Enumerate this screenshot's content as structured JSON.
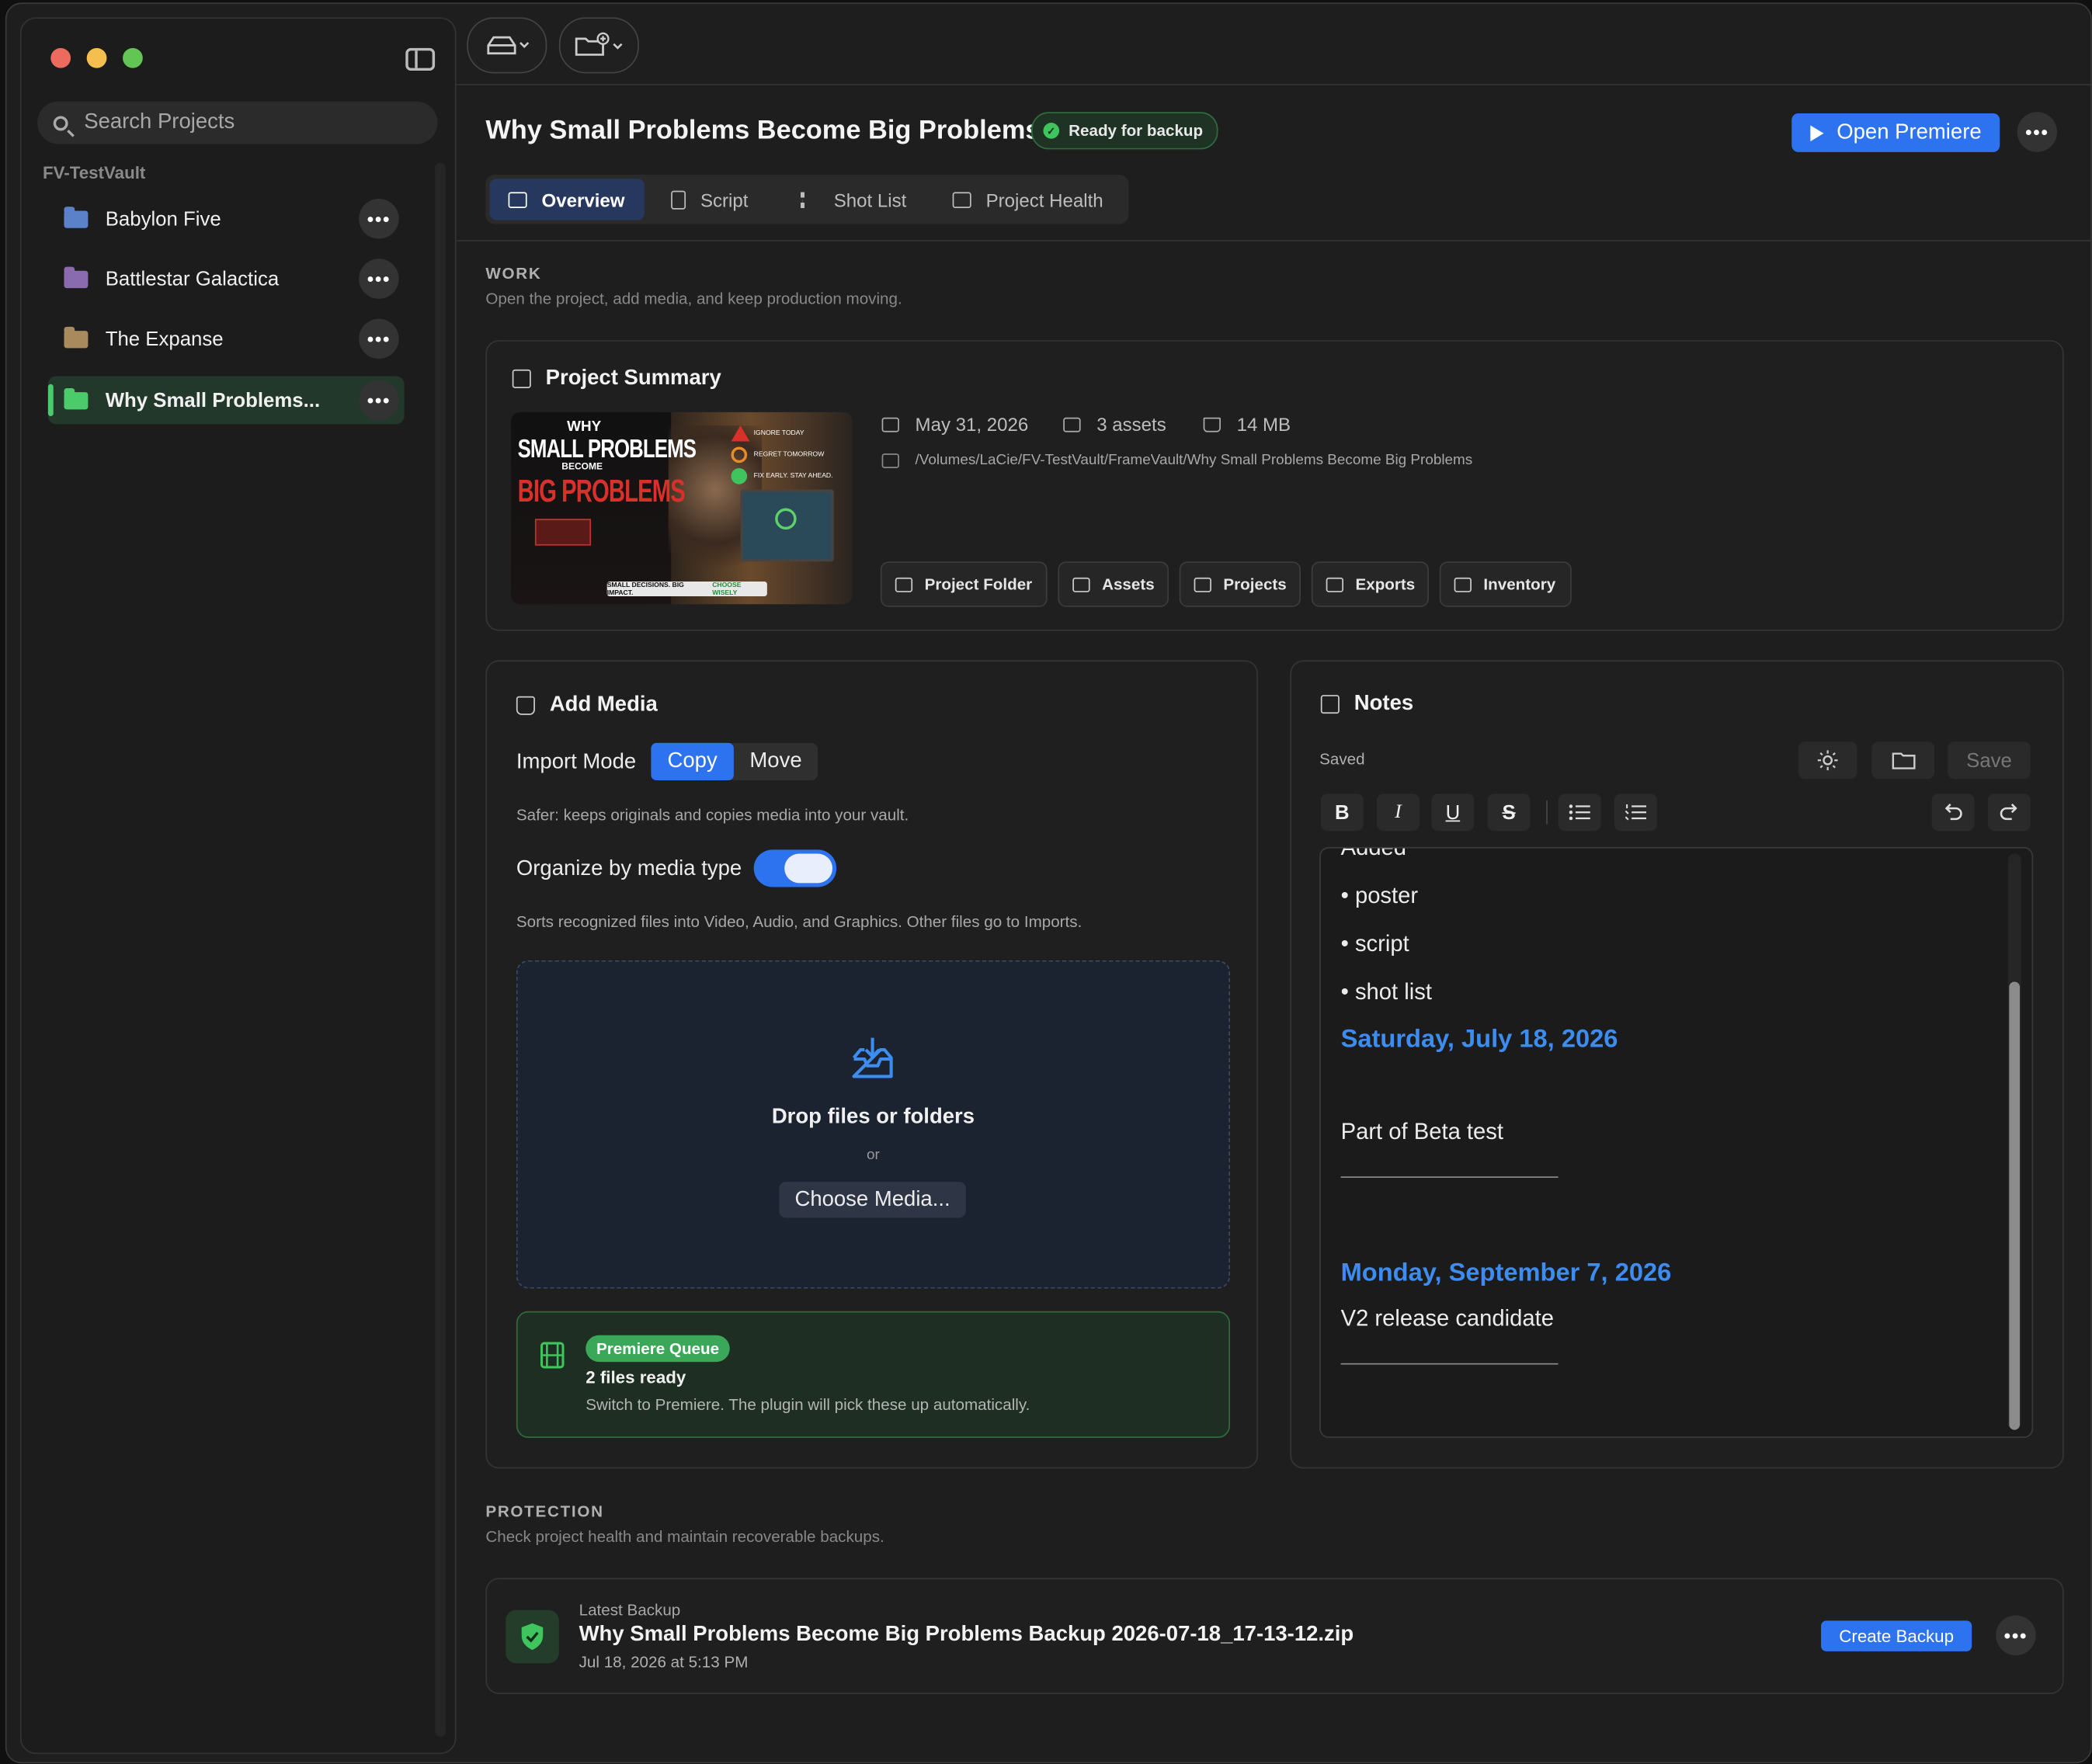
{
  "sidebar": {
    "search_placeholder": "Search Projects",
    "vault_label": "FV-TestVault",
    "projects": [
      {
        "label": "Babylon Five",
        "folder_color": "#5b82c9"
      },
      {
        "label": "Battlestar Galactica",
        "folder_color": "#8a6bb0"
      },
      {
        "label": "The Expanse",
        "folder_color": "#a88a5c"
      },
      {
        "label": "Why Small Problems...",
        "folder_color": "#4ccb6a"
      }
    ]
  },
  "header": {
    "title": "Why Small Problems Become Big Problems",
    "status_badge": "Ready for backup",
    "open_button": "Open Premiere",
    "tabs": [
      {
        "label": "Overview"
      },
      {
        "label": "Script"
      },
      {
        "label": "Shot List"
      },
      {
        "label": "Project Health"
      }
    ]
  },
  "work": {
    "title": "WORK",
    "subtitle": "Open the project, add media, and keep production moving."
  },
  "summary": {
    "title": "Project Summary",
    "date": "May 31, 2026",
    "assets": "3 assets",
    "size": "14 MB",
    "path": "/Volumes/LaCie/FV-TestVault/FrameVault/Why Small Problems Become Big Problems",
    "thumb": {
      "line1": "WHY",
      "line2": "SMALL PROBLEMS",
      "line3": "BECOME",
      "line4": "BIG PROBLEMS",
      "caption_a": "SMALL DECISIONS. BIG IMPACT.",
      "caption_b": "CHOOSE WISELY",
      "list": [
        "IGNORE TODAY",
        "REGRET TOMORROW",
        "FIX EARLY. STAY AHEAD."
      ]
    },
    "buttons": [
      "Project Folder",
      "Assets",
      "Projects",
      "Exports",
      "Inventory"
    ]
  },
  "add_media": {
    "title": "Add Media",
    "import_mode_label": "Import Mode",
    "modes": [
      "Copy",
      "Move"
    ],
    "mode_help": "Safer: keeps originals and copies media into your vault.",
    "organize_label": "Organize by media type",
    "organize_on": true,
    "organize_help": "Sorts recognized files into Video, Audio, and Graphics. Other files go to Imports.",
    "drop_title": "Drop files or folders",
    "drop_or": "or",
    "choose_button": "Choose Media...",
    "queue_badge": "Premiere Queue",
    "queue_title": "2 files ready",
    "queue_text": "Switch to Premiere. The plugin will pick these up automatically."
  },
  "notes": {
    "title": "Notes",
    "status": "Saved",
    "save_button": "Save",
    "format": {
      "bold": "B",
      "italic": "I",
      "underline": "U",
      "strike": "S"
    },
    "content": {
      "partial": "Added",
      "bullets": [
        "poster",
        "script",
        "shot list"
      ],
      "date1": "Saturday, July 18, 2026",
      "line1": "Part of Beta test",
      "date2": "Monday, September 7, 2026",
      "line2": "V2 release candidate"
    }
  },
  "protection": {
    "title": "PROTECTION",
    "subtitle": "Check project health and maintain recoverable backups.",
    "latest_label": "Latest Backup",
    "backup_name": "Why Small Problems Become Big Problems Backup 2026-07-18_17-13-12.zip",
    "backup_time": "Jul 18, 2026 at 5:13 PM",
    "create_button": "Create Backup"
  },
  "colors": {
    "accent": "#2d73f0",
    "success": "#3fc45e",
    "link_date": "#3d8cf0"
  }
}
